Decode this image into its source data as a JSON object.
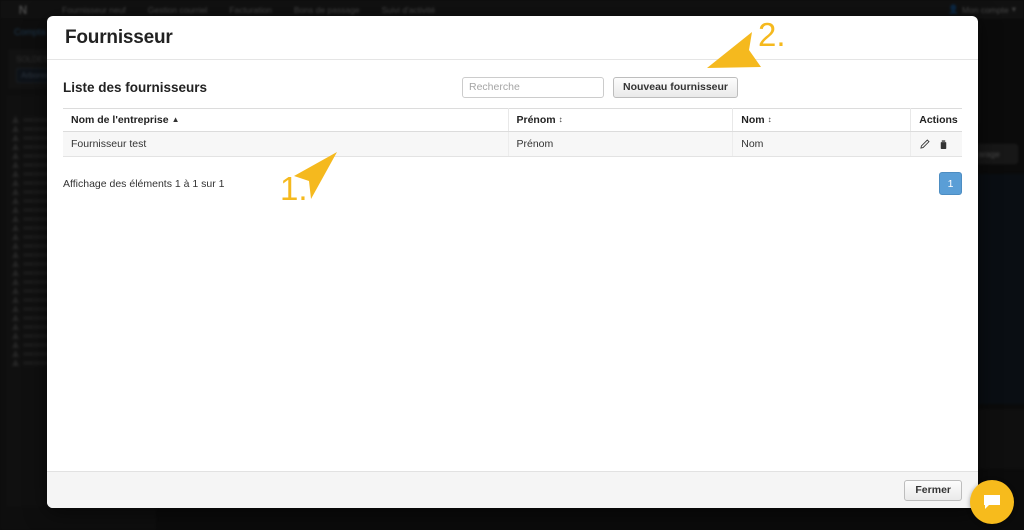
{
  "background": {
    "logo": "N",
    "nav_items": [
      "Fournisseur neuf",
      "Gestion courriel",
      "Facturation",
      "Bons de passage",
      "Suivi d'activité"
    ],
    "account_label": "Mon compte",
    "account_icon": "user-icon",
    "caret_icon": "chevron-down-icon",
    "sidebar": {
      "title": "Compta",
      "panel_label": "SOLDES",
      "panel_input_value": "Arbores",
      "tree_title": "F"
    },
    "right_panel": {
      "button_label": "arage"
    }
  },
  "modal": {
    "title": "Fournisseur",
    "list_title": "Liste des fournisseurs",
    "search": {
      "placeholder": "Recherche",
      "value": ""
    },
    "new_button_label": "Nouveau fournisseur",
    "table": {
      "columns": [
        {
          "label": "Nom de l'entreprise",
          "sort": "asc",
          "sort_icon": "sort-asc-icon"
        },
        {
          "label": "Prénom",
          "sort": "none",
          "sort_icon": "sort-both-icon"
        },
        {
          "label": "Nom",
          "sort": "none",
          "sort_icon": "sort-both-icon"
        },
        {
          "label": "Actions",
          "sort": null,
          "sort_icon": null
        }
      ],
      "rows": [
        {
          "company": "Fournisseur test",
          "first_name": "Prénom",
          "last_name": "Nom",
          "edit_icon": "pencil-icon",
          "delete_icon": "trash-icon"
        }
      ]
    },
    "info_text": "Affichage des éléments 1 à 1 sur 1",
    "pagination": {
      "current_page": "1"
    },
    "close_button_label": "Fermer"
  },
  "annotations": [
    {
      "number": "1.",
      "arrow_direction": "up-right"
    },
    {
      "number": "2.",
      "arrow_direction": "left"
    }
  ],
  "chat_widget": {
    "icon": "chat-bubble-icon"
  },
  "colors": {
    "accent_yellow": "#F5B91E",
    "pagination_blue": "#5A9ED6",
    "modal_background": "#FFFFFF",
    "page_background": "#1B1B1B"
  }
}
